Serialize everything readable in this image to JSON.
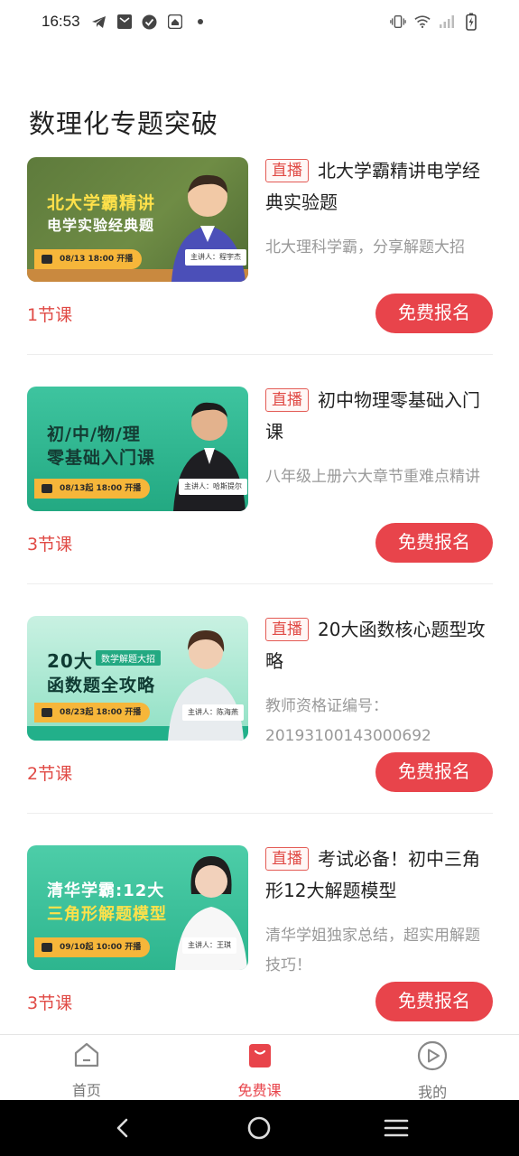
{
  "status_bar": {
    "time": "16:53",
    "left_icons": [
      "telegram-icon",
      "mail-icon",
      "check-circle-icon",
      "app-icon",
      "dot-icon"
    ],
    "right_icons": [
      "vibrate-icon",
      "wifi-icon",
      "signal-icon",
      "battery-charging-icon"
    ]
  },
  "section_title": "数理化专题突破",
  "colors": {
    "accent": "#e8444b",
    "live_badge": "#e04a45",
    "desc": "#999999"
  },
  "courses": [
    {
      "badge": "直播",
      "title": "北大学霸精讲电学经典实验题",
      "desc": "北大理科学霸，分享解题大招",
      "lessons": "1节课",
      "button": "免费报名",
      "thumb": {
        "line1": "北大学霸精讲",
        "line2": "电学实验经典题",
        "date": "08/13 18:00 开播",
        "teacher": "主讲人：程宇杰",
        "theme": "green-chalkboard"
      }
    },
    {
      "badge": "直播",
      "title": "初中物理零基础入门课",
      "desc": "八年级上册六大章节重难点精讲",
      "lessons": "3节课",
      "button": "免费报名",
      "thumb": {
        "line1": "初/中/物/理",
        "line2": "零基础入门课",
        "date": "08/13起 18:00 开播",
        "teacher": "主讲人：哈斯提尔",
        "theme": "teal"
      }
    },
    {
      "badge": "直播",
      "title": "20大函数核心题型攻略",
      "desc": "教师资格证编号：20193100143000692",
      "lessons": "2节课",
      "button": "免费报名",
      "thumb": {
        "line1": "20大",
        "tag": "数学解题大招",
        "line2": "函数题全攻略",
        "date": "08/23起 18:00 开播",
        "teacher": "主讲人：陈海燕",
        "theme": "mint"
      }
    },
    {
      "badge": "直播",
      "title": "考试必备！初中三角形12大解题模型",
      "desc": "清华学姐独家总结，超实用解题技巧！",
      "lessons": "3节课",
      "button": "免费报名",
      "thumb": {
        "line1": "清华学霸:12大",
        "line2": "三角形解题模型",
        "date": "09/10起 10:00 开播",
        "teacher": "主讲人：王琪",
        "theme": "teal2"
      }
    }
  ],
  "tabbar": {
    "tabs": [
      {
        "label": "首页",
        "icon": "home-icon",
        "active": false
      },
      {
        "label": "免费课",
        "icon": "free-course-icon",
        "active": true
      },
      {
        "label": "我的",
        "icon": "play-circle-icon",
        "active": false
      }
    ]
  },
  "navbar": {
    "buttons": [
      "back-icon",
      "home-circle-icon",
      "menu-icon"
    ]
  }
}
